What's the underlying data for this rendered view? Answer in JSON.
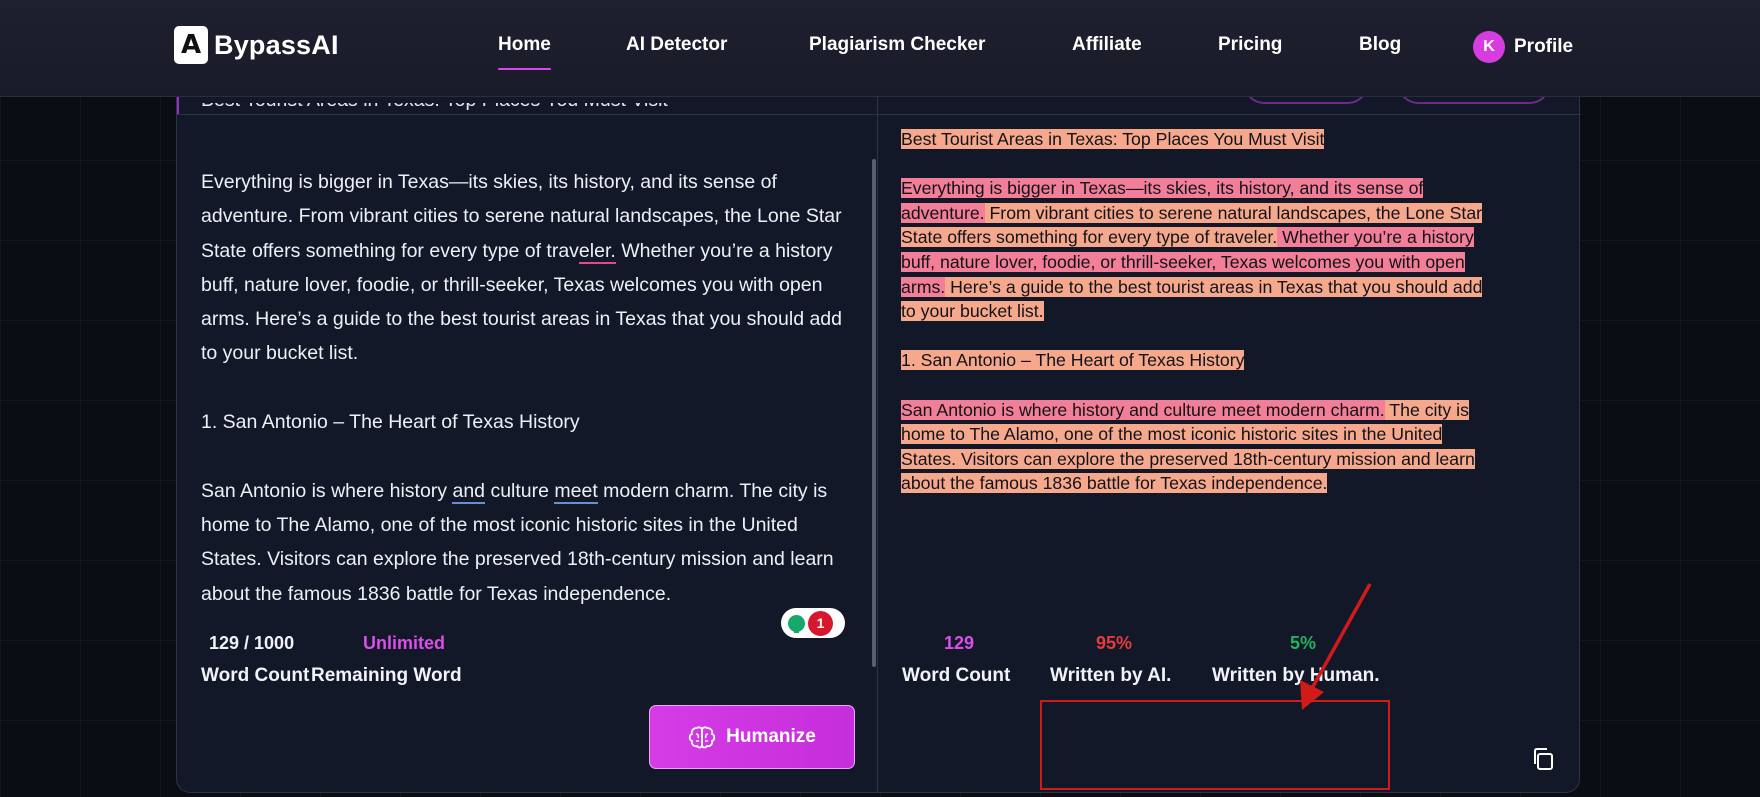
{
  "brand": {
    "name": "BypassAI",
    "logo_glyph": "A"
  },
  "nav": {
    "items": [
      {
        "label": "Home",
        "active": true
      },
      {
        "label": "AI Detector",
        "active": false
      },
      {
        "label": "Plagiarism Checker",
        "active": false
      },
      {
        "label": "Affiliate",
        "active": false
      },
      {
        "label": "Pricing",
        "active": false
      },
      {
        "label": "Blog",
        "active": false
      }
    ],
    "profile": {
      "avatar_initial": "K",
      "label": "Profile"
    }
  },
  "editor": {
    "cut_title": "Best Tourist Areas in Texas: Top Places You Must Visit",
    "p1_a": "Everything is bigger in Texas—its skies, its history, and its sense of adventure. From vibrant cities to serene natural landscapes, the Lone Star State offers something for every type of trav",
    "p1_u": "eler.",
    "p1_b": " Whether you’re a history buff, nature lover, foodie, or thrill-seeker, Texas welcomes you with open arms. Here’s a guide to the best tourist areas in Texas that you should add to your bucket list.",
    "h1": "1. San Antonio – The Heart of Texas History",
    "p2_a": "San Antonio is where history ",
    "p2_u1": "and",
    "p2_b": " culture ",
    "p2_u2": "meet",
    "p2_c": " modern charm. The city is home to The Alamo, one of the most iconic historic sites in the United States. Visitors can explore the preserved 18th-century mission and learn about the famous 1836 battle for Texas independence.",
    "badge_count": "1"
  },
  "left_footer": {
    "word_count_value": "129 / 1000",
    "word_count_label": "Word Count",
    "remaining_value": "Unlimited",
    "remaining_label": "Remaining Word",
    "humanize_label": "Humanize"
  },
  "output": {
    "title": "Best Tourist Areas in Texas: Top Places You Must Visit",
    "p1_s1": "Everything is bigger in Texas—its skies, its history, and its sense of adventure.",
    "p1_s2": " From vibrant cities to serene natural landscapes, the Lone Star State offers something for every type of traveler.",
    "p1_s3": " Whether you’re a history buff, nature lover, foodie, or thrill-seeker, Texas welcomes you with open arms.",
    "p1_s4": " Here’s a guide to the best tourist areas in Texas that you should add to your bucket list.",
    "h1": "1. San Antonio – The Heart of Texas History",
    "p2_s1": "San Antonio is where history and culture meet modern charm.",
    "p2_s2": " The city is home to The Alamo, one of the most iconic historic sites in the United States.",
    "p2_s3": " Visitors can explore the preserved 18th-century mission and learn about the famous 1836 battle for Texas independence."
  },
  "right_footer": {
    "word_count_value": "129",
    "word_count_label": "Word Count",
    "ai_value": "95%",
    "ai_label": "Written by AI.",
    "human_value": "5%",
    "human_label": "Written by Human."
  },
  "colors": {
    "accent": "#d946ef",
    "ai_red": "#e53b3b",
    "human_green": "#22b35e",
    "unlimited_purple": "#d94fe8",
    "annotation_red": "#d11a1a"
  }
}
